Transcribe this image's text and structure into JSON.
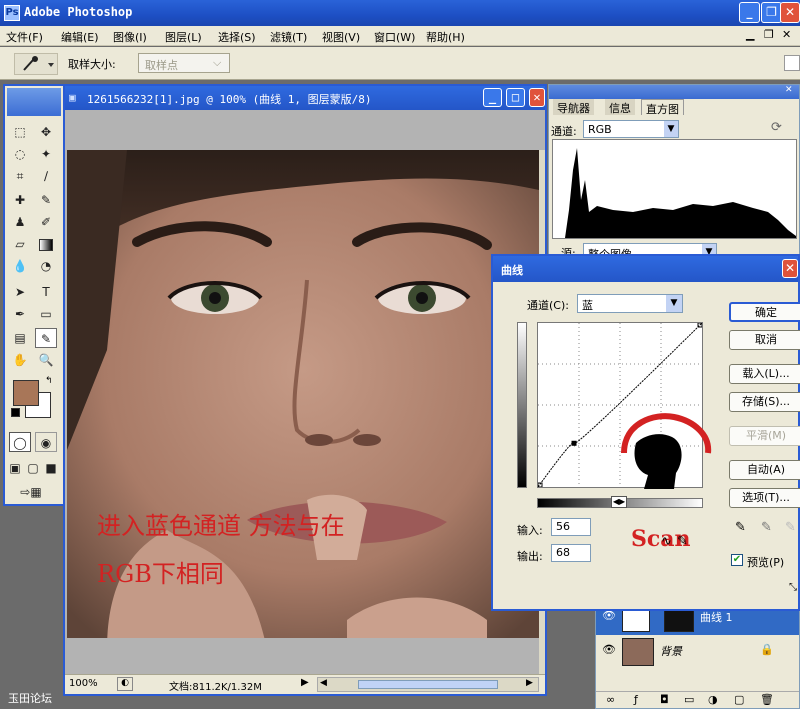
{
  "app": {
    "title": "Adobe Photoshop",
    "icon": "photoshop-icon"
  },
  "window_controls": {
    "minimize": "_",
    "restore": "❐",
    "close": "✕"
  },
  "menu": [
    "文件(F)",
    "编辑(E)",
    "图像(I)",
    "图层(L)",
    "选择(S)",
    "滤镜(T)",
    "视图(V)",
    "窗口(W)",
    "帮助(H)"
  ],
  "options": {
    "sample_size_label": "取样大小:",
    "sample_size_value": "取样点"
  },
  "document": {
    "title": "1261566232[1].jpg @ 100% (曲线 1, 图层蒙版/8)",
    "zoom": "100%",
    "doc_info": "文档:811.2K/1.32M",
    "overlay_line1": "进入蓝色通道  方法与在",
    "overlay_line2": "RGB下相同"
  },
  "nav_panel": {
    "tabs": [
      "导航器",
      "信息",
      "直方图"
    ],
    "active_tab": 2,
    "channel_label": "通道:",
    "channel_value": "RGB",
    "source_label": "源:",
    "source_value": "整个图像"
  },
  "curves": {
    "title": "曲线",
    "channel_label": "通道(C):",
    "channel_value": "蓝",
    "input_label": "输入:",
    "input_value": "56",
    "output_label": "输出:",
    "output_value": "68",
    "buttons": {
      "ok": "确定",
      "cancel": "取消",
      "load": "载入(L)...",
      "save": "存储(S)...",
      "smooth": "平滑(M)",
      "auto": "自动(A)",
      "options": "选项(T)..."
    },
    "preview_label": "预览(P)",
    "preview_checked": true,
    "watermark": "Scan",
    "curve_point": {
      "input": 56,
      "output": 68
    }
  },
  "layers": {
    "items": [
      {
        "name": "曲线 1",
        "type": "adjustment"
      },
      {
        "name": "背景",
        "type": "background",
        "locked": true
      }
    ]
  },
  "forum_watermark": "玉田论坛",
  "colors": {
    "xp_blue": "#2456c8",
    "foreground": "#a87658",
    "background": "#ffffff",
    "overlay_text": "#d32222"
  }
}
